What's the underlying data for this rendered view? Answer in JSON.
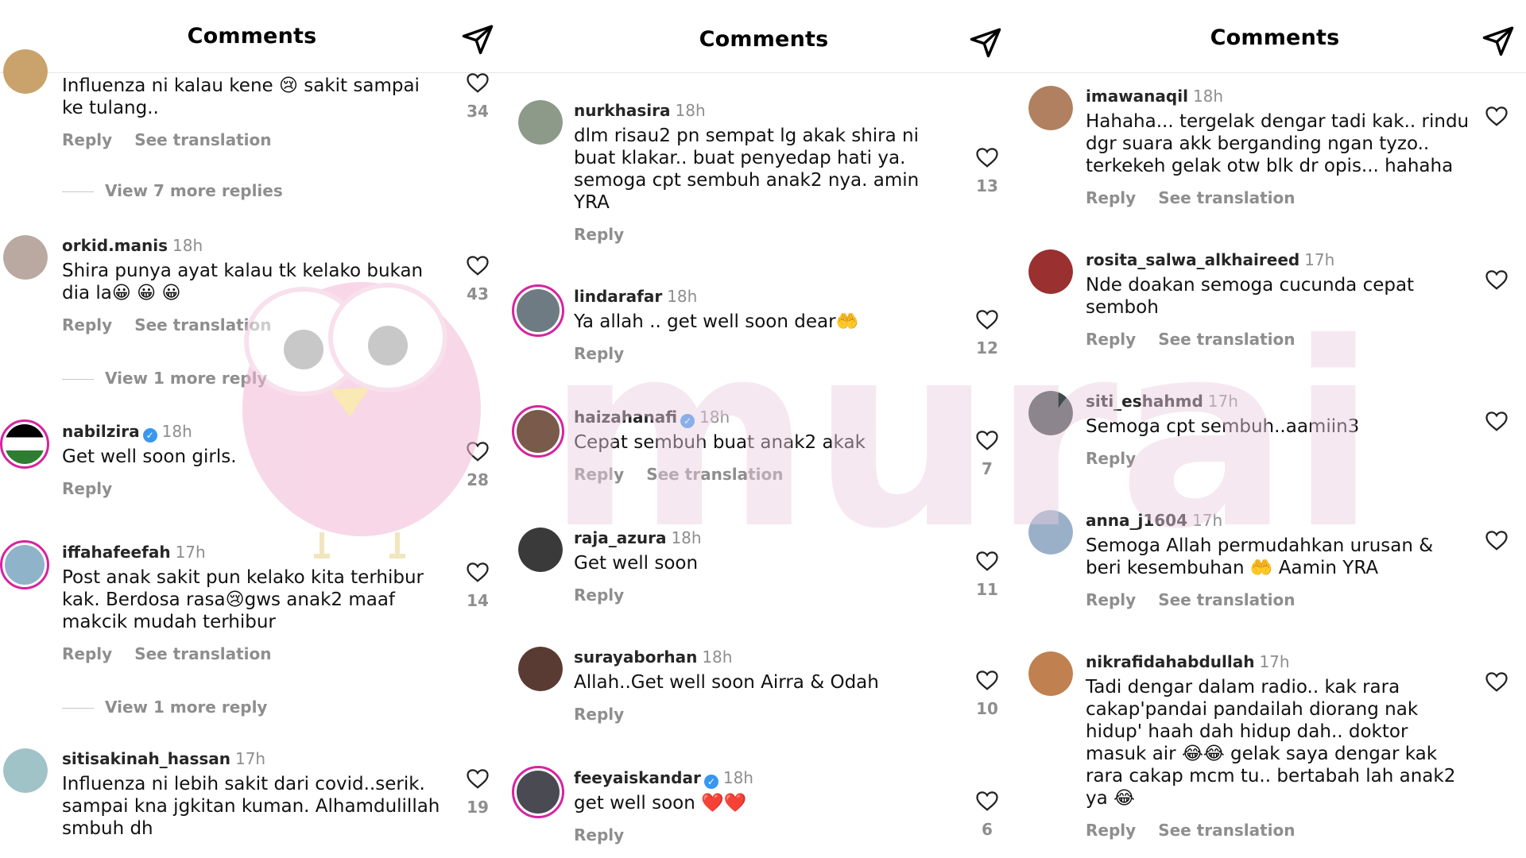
{
  "panels": [
    {
      "title": "Comments",
      "comments": [
        {
          "user": "",
          "time": "",
          "text": "Influenza ni kalau kene 😢 sakit sampai\nke tulang..",
          "reply": "Reply",
          "translate": "See translation",
          "likes": "34",
          "more": "View 7 more replies",
          "avatar_color": "#c9a36b"
        },
        {
          "user": "orkid.manis",
          "time": "18h",
          "text": "Shira punya ayat kalau tk kelako bukan\ndia la😀 😀 😀",
          "reply": "Reply",
          "translate": "See translation",
          "likes": "43",
          "more": "View 1 more reply",
          "avatar_color": "#b9a9a0"
        },
        {
          "user": "nabilzira",
          "verified": true,
          "time": "18h",
          "text": "Get well soon girls.",
          "reply": "Reply",
          "translate": "",
          "likes": "28",
          "more": "",
          "avatar_color": "#2e7d32"
        },
        {
          "user": "iffahafeefah",
          "time": "17h",
          "text": "Post anak sakit pun kelako kita terhibur\nkak. Berdosa rasa😢gws anak2 maaf\nmakcik mudah terhibur",
          "reply": "Reply",
          "translate": "See translation",
          "likes": "14",
          "more": "View 1 more reply",
          "avatar_color": "#8fb3c9"
        },
        {
          "user": "sitisakinah_hassan",
          "time": "17h",
          "text": "Influenza ni lebih sakit dari covid..serik.\nsampai kna jgkitan kuman. Alhamdulillah\nsmbuh dh",
          "reply": "",
          "translate": "",
          "likes": "19",
          "more": "",
          "avatar_color": "#9fc3c7"
        }
      ]
    },
    {
      "title": "Comments",
      "comments": [
        {
          "user": "nurkhasira",
          "time": "18h",
          "text": "dlm risau2 pn sempat lg akak shira ni\nbuat klakar.. buat penyedap hati ya.\nsemoga cpt sembuh anak2 nya. amin\nYRA",
          "reply": "Reply",
          "translate": "",
          "likes": "13",
          "avatar_color": "#8d9a8a"
        },
        {
          "user": "lindarafar",
          "time": "18h",
          "text": "Ya allah .. get well soon dear🤲",
          "reply": "Reply",
          "translate": "",
          "likes": "12",
          "avatar_color": "#6f7b82"
        },
        {
          "user": "haizahanafi",
          "verified": true,
          "time": "18h",
          "text": "Cepat sembuh buat anak2 akak",
          "reply": "Reply",
          "translate": "See translation",
          "likes": "7",
          "avatar_color": "#7a5a4a"
        },
        {
          "user": "raja_azura",
          "time": "18h",
          "text": "Get well soon",
          "reply": "Reply",
          "translate": "",
          "likes": "11",
          "avatar_color": "#3a3a3a"
        },
        {
          "user": "surayaborhan",
          "time": "18h",
          "text": "Allah..Get well soon Airra & Odah",
          "reply": "Reply",
          "translate": "",
          "likes": "10",
          "avatar_color": "#5a3b33"
        },
        {
          "user": "feeyaiskandar",
          "verified": true,
          "time": "18h",
          "text": "get well soon ❤️❤️",
          "reply": "Reply",
          "translate": "",
          "likes": "6",
          "avatar_color": "#4a4a52"
        }
      ]
    },
    {
      "title": "Comments",
      "comments": [
        {
          "user": "imawanaqil",
          "time": "18h",
          "text": "Hahaha... tergelak dengar tadi kak.. rindu\ndgr suara akk berganding ngan tyzo..\nterkekeh gelak otw blk dr opis... hahaha",
          "reply": "Reply",
          "translate": "See translation",
          "likes": "",
          "avatar_color": "#b08060"
        },
        {
          "user": "rosita_salwa_alkhaireed",
          "time": "17h",
          "text": "Nde doakan semoga cucunda cepat\nsemboh",
          "reply": "Reply",
          "translate": "See translation",
          "likes": "",
          "avatar_color": "#9a3030"
        },
        {
          "user": "siti_eshahmd",
          "time": "17h",
          "text": "Semoga cpt sembuh..aamiin3",
          "reply": "Reply",
          "translate": "",
          "likes": "",
          "avatar_color": "#3f4a4a"
        },
        {
          "user": "anna_j1604",
          "time": "17h",
          "text": "Semoga Allah permudahkan urusan &\nberi kesembuhan 🤲 Aamin YRA",
          "reply": "Reply",
          "translate": "See translation",
          "likes": "",
          "avatar_color": "#9ab0c8"
        },
        {
          "user": "nikrafidahabdullah",
          "time": "17h",
          "text": "Tadi dengar dalam radio.. kak rara\ncakap'pandai pandailah diorang nak\nhidup' haah dah hidup dah.. doktor\nmasuk air 😂😂 gelak saya dengar kak\nrara cakap mcm tu.. bertabah lah anak2\nya 😂",
          "reply": "Reply",
          "translate": "See translation",
          "likes": "",
          "avatar_color": "#c08050"
        }
      ]
    }
  ],
  "watermark": {
    "text": "murai",
    "color": "#e8c6dc"
  },
  "icons": {
    "send": "send-icon",
    "like": "heart-outline-icon",
    "verified": "verified-badge-icon"
  }
}
